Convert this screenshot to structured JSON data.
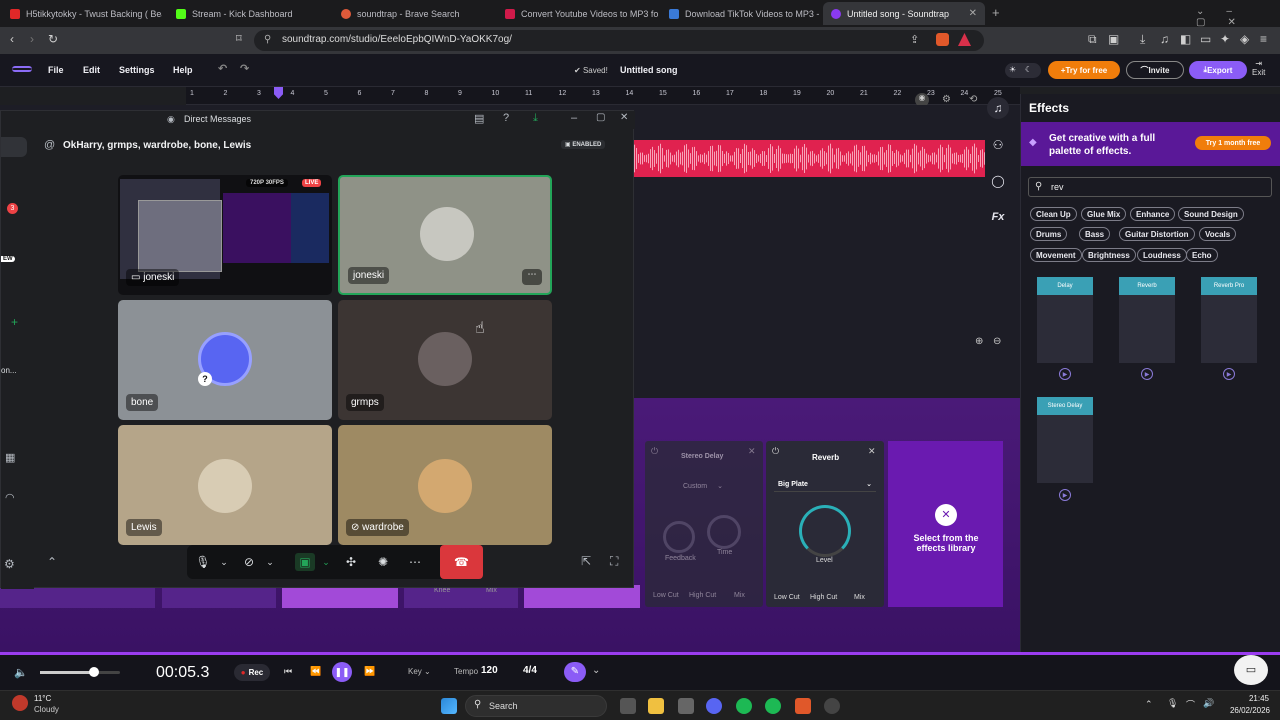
{
  "browser": {
    "tabs": [
      {
        "label": "H5tikkytokky - Twust Backing ( Beat ...",
        "color": "#e02828"
      },
      {
        "label": "Stream - Kick Dashboard",
        "color": "#53fc18"
      },
      {
        "label": "soundtrap - Brave Search",
        "color": "#e05a3a"
      },
      {
        "label": "Convert Youtube Videos to MP3 for ...",
        "color": "#d01a4a"
      },
      {
        "label": "Download TikTok Videos to MP3 - Fr...",
        "color": "#3a7ad8"
      },
      {
        "label": "Untitled song - Soundtrap",
        "color": "#8a3af0"
      }
    ],
    "url": "soundtrap.com/studio/EeeloEpbQIWnD-YaOKK7og/"
  },
  "soundtrap": {
    "menu": [
      "File",
      "Edit",
      "Settings",
      "Help"
    ],
    "saved_label": "Saved!",
    "song_title": "Untitled song",
    "try_free": "Try for free",
    "invite": "Invite",
    "export": "Export",
    "exit": "Exit",
    "ruler_ticks": [
      "1",
      "2",
      "3",
      "4",
      "5",
      "6",
      "7",
      "8",
      "9",
      "10",
      "11",
      "12",
      "13",
      "14",
      "15",
      "16",
      "17",
      "18",
      "19",
      "20",
      "21",
      "22",
      "23",
      "24",
      "25"
    ],
    "stereo_delay": {
      "title": "Stereo Delay",
      "preset": "Custom",
      "knobs": [
        "Feedback",
        "Time",
        "Low Cut",
        "High Cut",
        "Mix"
      ]
    },
    "reverb": {
      "title": "Reverb",
      "preset": "Big Plate",
      "knobs": [
        "Level",
        "Low Cut",
        "High Cut",
        "Mix"
      ]
    },
    "bg_knob_labels": [
      "Knee",
      "Mix"
    ],
    "select_library": "Select from the effects library"
  },
  "effects_panel": {
    "title": "Effects",
    "promo": "Get creative with a full palette of effects.",
    "promo_button": "Try 1 month free",
    "search_value": "rev",
    "chips": [
      "Clean Up",
      "Glue Mix",
      "Enhance",
      "Sound Design",
      "Drums",
      "Bass",
      "Guitar Distortion",
      "Vocals",
      "Movement",
      "Brightness",
      "Loudness",
      "Echo"
    ],
    "presets": [
      "Delay",
      "Reverb",
      "Reverb Pro",
      "Stereo Delay"
    ]
  },
  "transport": {
    "time": "00:05.3",
    "rec": "Rec",
    "key_label": "Key",
    "tempo_label": "Tempo",
    "tempo": "120",
    "signature": "4/4",
    "volume_level": 0.68
  },
  "discord": {
    "window_title": "Direct Messages",
    "group_name": "OkHarry, grmps, wardrobe, bone, Lewis",
    "enabled_badge": "ENABLED",
    "sidebar_badge": "3",
    "sidebar_new": "EW",
    "sidebar_text": "on...",
    "participants": [
      {
        "name": "joneski",
        "stream_badge": "720P 30FPS",
        "live_badge": "LIVE"
      },
      {
        "name": "joneski"
      },
      {
        "name": "bone"
      },
      {
        "name": "grmps"
      },
      {
        "name": "Lewis"
      },
      {
        "name": "wardrobe"
      }
    ]
  },
  "taskbar": {
    "weather_temp": "11°C",
    "weather_desc": "Cloudy",
    "search": "Search",
    "time": "21:45",
    "date": "26/02/2026"
  },
  "colors": {
    "accent": "#9b3cf0",
    "live": "#ed4245",
    "track": "#e0224f",
    "discord_bg": "#1e1f22"
  }
}
